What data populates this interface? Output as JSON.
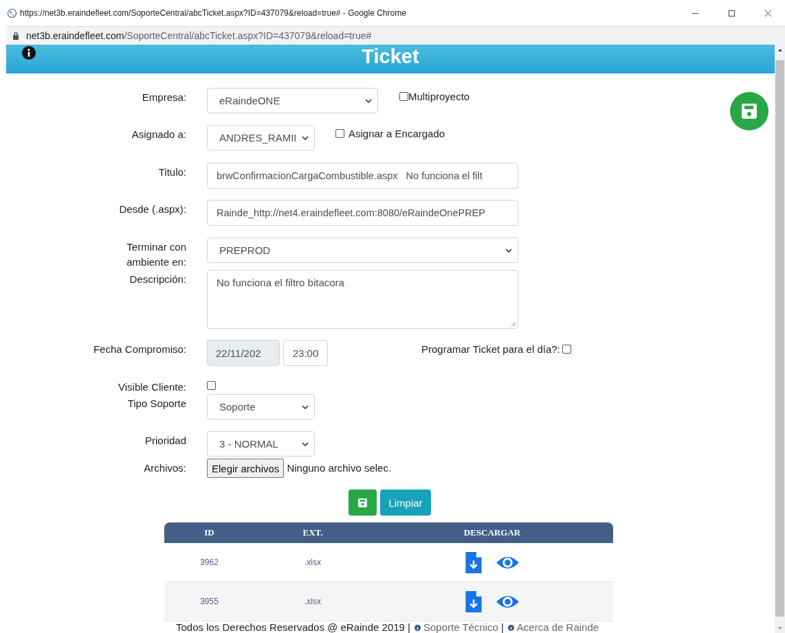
{
  "window": {
    "title": "https://net3b.eraindefleet.com/SoporteCentral/abcTicket.aspx?ID=437079&reload=true# - Google Chrome"
  },
  "address_bar": {
    "host": "net3b.eraindefleet.com",
    "path": "/SoporteCentral/abcTicket.aspx?ID=437079&reload=true#"
  },
  "header": {
    "title": "Ticket"
  },
  "form": {
    "rows": [
      {
        "label": "Empresa:",
        "kind": "select",
        "value": "eRaindeONE",
        "extra": {
          "label": "Multiproyecto",
          "checked": false
        }
      },
      {
        "label": "Asignado a:",
        "kind": "select",
        "value": "ANDRES_RAMII",
        "extra": {
          "label": "Asignar a Encargado",
          "checked": false
        }
      },
      {
        "label": "Titulo:",
        "kind": "text",
        "value": "brwConfirmacionCargaCombustible.aspx   No funciona el filt"
      },
      {
        "label": "Desde (.aspx):",
        "kind": "text",
        "value": "Rainde_http://net4.eraindefleet.com:8080/eRaindeOnePREP"
      },
      {
        "label": "Terminar con ambiente en:",
        "kind": "select",
        "value": "PREPROD"
      },
      {
        "label": "Descripción:",
        "kind": "textarea",
        "value": "No funciona el filtro bitacora"
      },
      {
        "label": "Fecha Compromiso:",
        "kind": "datetime",
        "value": "22/11/202",
        "disabled": true,
        "time": "23:00",
        "extra": {
          "label": "Programar Ticket para el día?:",
          "checked": false
        }
      },
      {
        "label": "Visible Cliente:",
        "kind": "checkbox",
        "checked": false
      },
      {
        "label": "Tipo Soporte",
        "kind": "select",
        "value": "Soporte"
      },
      {
        "label": "Prioridad",
        "kind": "select",
        "value": "3 - NORMAL"
      },
      {
        "label": "Archivos:",
        "kind": "file",
        "button": "Elegir archivos",
        "status": "Ninguno archivo selec."
      }
    ]
  },
  "actions": {
    "clear": "Limpiar"
  },
  "table": {
    "columns": [
      "ID",
      "EXT.",
      "DESCARGAR"
    ],
    "rows": [
      {
        "id": "3962",
        "ext": ".xlsx"
      },
      {
        "id": "3955",
        "ext": ".xlsx"
      }
    ]
  },
  "footer": {
    "text": "Todos los Derechos Reservados @ eRainde 2019 |",
    "links": [
      "Soporte Técnico",
      "Acerca de Rainde"
    ],
    "separator": "|"
  }
}
